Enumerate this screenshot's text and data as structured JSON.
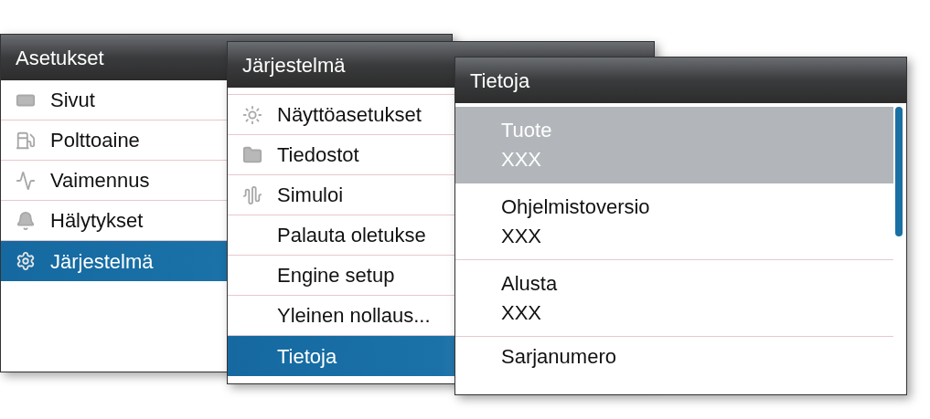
{
  "menus": [
    {
      "title": "Asetukset",
      "items": [
        {
          "label": "Sivut",
          "selected": false
        },
        {
          "label": "Polttoaine",
          "selected": false
        },
        {
          "label": "Vaimennus",
          "selected": false
        },
        {
          "label": "Hälytykset",
          "selected": false
        },
        {
          "label": "Järjestelmä",
          "selected": true
        }
      ]
    },
    {
      "title": "Järjestelmä",
      "items": [
        {
          "label": "Näyttöasetukset",
          "selected": false
        },
        {
          "label": "Tiedostot",
          "selected": false
        },
        {
          "label": "Simuloi",
          "selected": false
        },
        {
          "label": "Palauta oletukse",
          "selected": false
        },
        {
          "label": "Engine setup",
          "selected": false
        },
        {
          "label": "Yleinen nollaus...",
          "selected": false
        },
        {
          "label": "Tietoja",
          "selected": true
        }
      ]
    }
  ],
  "details": {
    "title": "Tietoja",
    "items": [
      {
        "label": "Tuote",
        "value": "XXX",
        "selected": true
      },
      {
        "label": "Ohjelmistoversio",
        "value": "XXX",
        "selected": false
      },
      {
        "label": "Alusta",
        "value": "XXX",
        "selected": false
      },
      {
        "label": "Sarjanumero",
        "selected": false
      }
    ]
  }
}
